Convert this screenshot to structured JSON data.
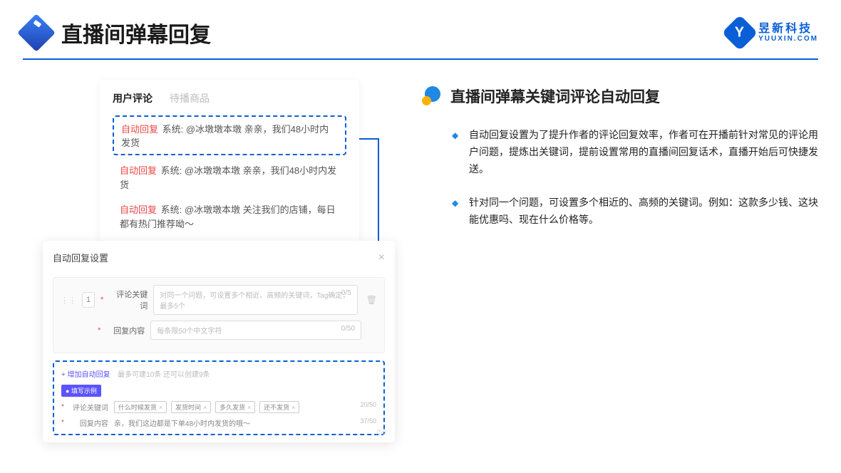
{
  "header": {
    "title": "直播间弹幕回复",
    "brand_zh": "昱新科技",
    "brand_en": "YUUXIN.COM",
    "logo_letter": "Y"
  },
  "comments": {
    "tab_active": "用户评论",
    "tab_inactive": "待播商品",
    "autoreply_tag": "自动回复",
    "line1_rest": " 系统: @冰墩墩本墩 亲亲，我们48小时内发货",
    "line2_rest": " 系统: @冰墩墩本墩 亲亲，我们48小时内发货",
    "line3_rest": " 系统: @冰墩墩本墩 关注我们的店铺，每日都有热门推荐呦～"
  },
  "modal": {
    "title": "自动回复设置",
    "index": "1",
    "label_keyword": "评论关键词",
    "placeholder_keyword": "对同一个问题，可设置多个相近、高频的关键词，Tag确定，最多5个",
    "counter_keyword": "0/5",
    "label_content": "回复内容",
    "placeholder_content": "每条限50个中文字符",
    "counter_content": "0/50",
    "ghost_counter": "/50"
  },
  "example": {
    "add_link": "+ 增加自动回复",
    "add_hint": "最多可建10条 还可以创建9条",
    "badge": "● 填写示例",
    "label_keyword": "评论关键词",
    "tags": [
      "什么时候发货",
      "发货时间",
      "多久发货",
      "还不发货"
    ],
    "counter_keyword": "20/50",
    "label_content": "回复内容",
    "content_text": "亲，我们这边都是下单48小时内发货的哦～",
    "counter_content": "37/50"
  },
  "right": {
    "section_title": "直播间弹幕关键词评论自动回复",
    "bullet1": "自动回复设置为了提升作者的评论回复效率，作者可在开播前针对常见的评论用户问题，提炼出关键词，提前设置常用的直播间回复话术，直播开始后可快捷发送。",
    "bullet2": "针对同一个问题，可设置多个相近的、高频的关键词。例如：这款多少钱、这块能优惠吗、现在什么价格等。"
  }
}
